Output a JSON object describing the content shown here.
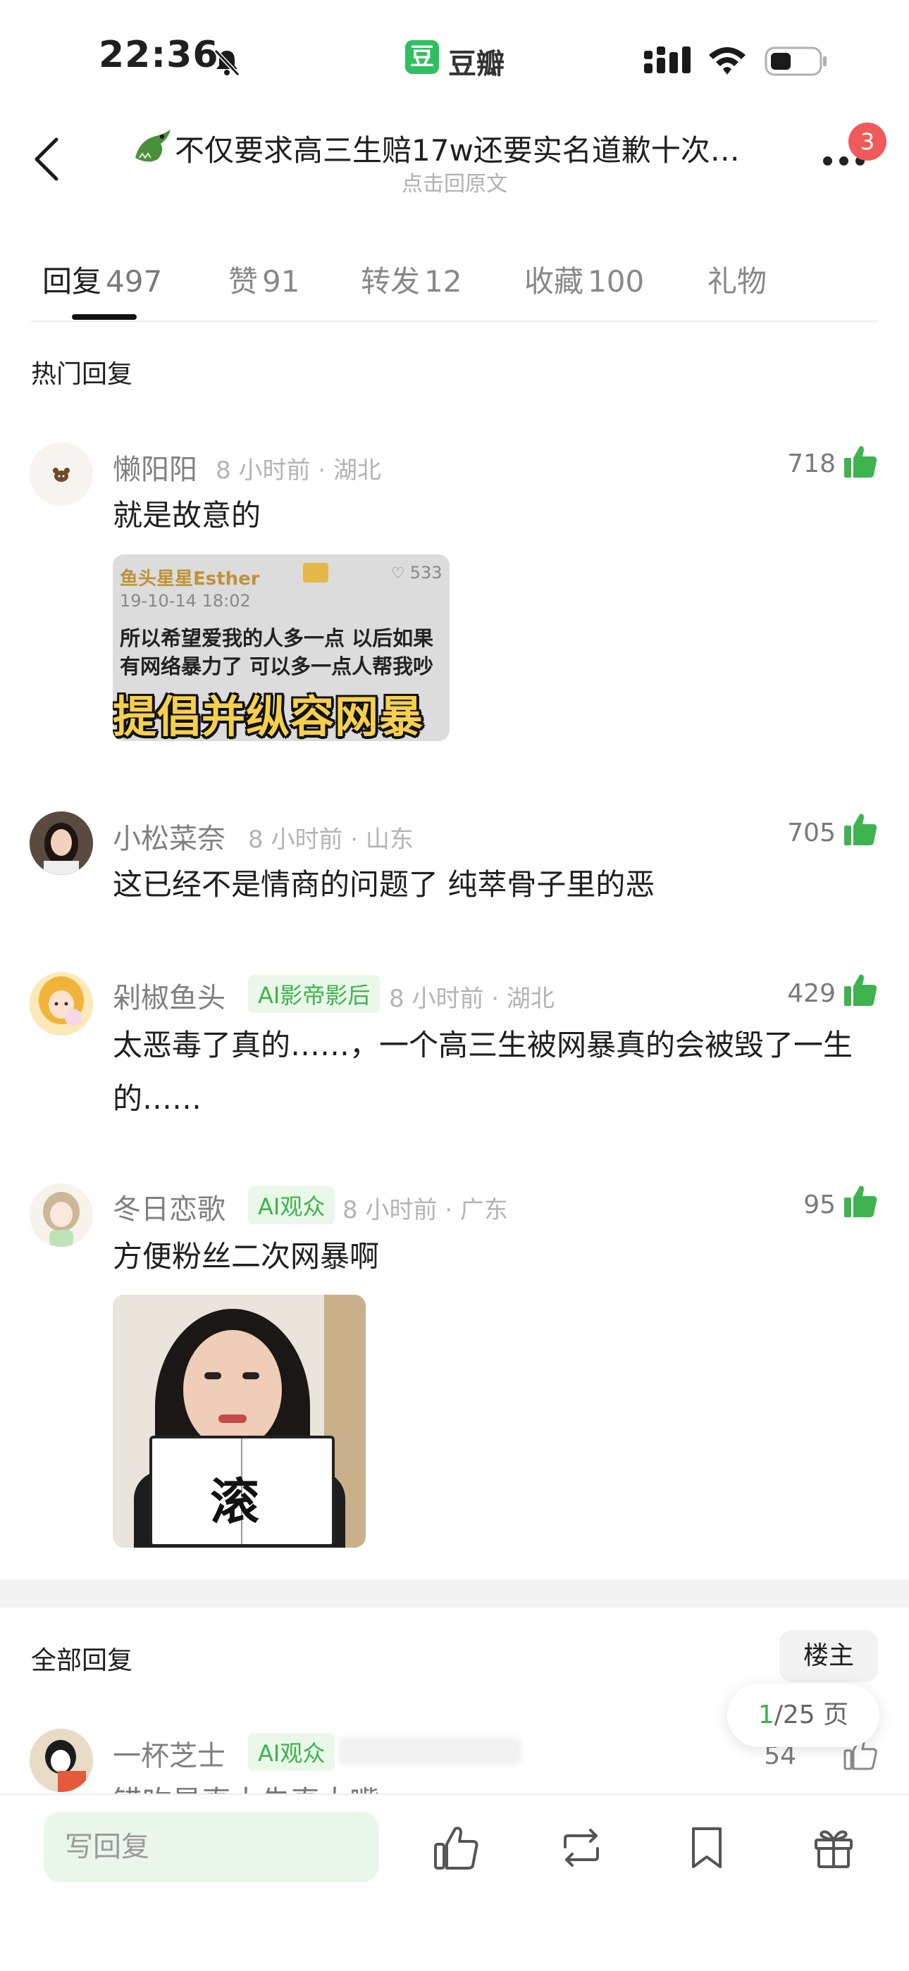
{
  "status_bar": {
    "time": "22:36",
    "app_name": "豆瓣",
    "app_logo_char": "豆"
  },
  "nav": {
    "title": "不仅要求高三生赔17w还要实名道歉十次…",
    "subtitle": "点击回原文",
    "notification_count": "3"
  },
  "tabs": [
    {
      "label": "回复",
      "count": "497"
    },
    {
      "label": "赞",
      "count": "91"
    },
    {
      "label": "转发",
      "count": "12"
    },
    {
      "label": "收藏",
      "count": "100"
    },
    {
      "label": "礼物",
      "count": ""
    }
  ],
  "hot": {
    "title": "热门回复",
    "comments": [
      {
        "name": "懒阳阳",
        "tag": "",
        "meta": "8 小时前 · 湖北",
        "likes": "718",
        "text": "就是故意的"
      },
      {
        "name": "小松菜奈",
        "tag": "",
        "meta": "8 小时前 · 山东",
        "likes": "705",
        "text": "这已经不是情商的问题了 纯萃骨子里的恶"
      },
      {
        "name": "剁椒鱼头",
        "tag": "AI影帝影后",
        "meta": "8 小时前 · 湖北",
        "likes": "429",
        "text": "太恶毒了真的……，一个高三生被网暴真的会被毁了一生的……"
      },
      {
        "name": "冬日恋歌",
        "tag": "AI观众",
        "meta": "8 小时前 · 广东",
        "likes": "95",
        "text": "方便粉丝二次网暴啊"
      }
    ]
  },
  "image1": {
    "header": "鱼头星星Esther",
    "likes": "533",
    "date": "19-10-14 18:02",
    "line1": "所以希望爱我的人多一点 以后如果",
    "line2": "有网络暴力了 可以多一点人帮我吵",
    "caption": "提倡并纵容网暴"
  },
  "image2": {
    "word": "滚"
  },
  "all": {
    "title": "全部回复",
    "owner_button": "楼主",
    "pager": {
      "current": "1",
      "total": "/25 页"
    },
    "first": {
      "name": "一杯芝士",
      "tag": "AI观众",
      "likes": "54",
      "text": "错吹是真大先真大嘴"
    }
  },
  "bottom": {
    "reply_placeholder": "写回复"
  }
}
